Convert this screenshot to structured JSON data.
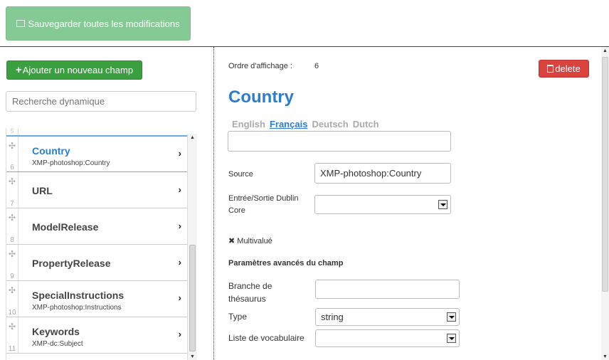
{
  "toolbar": {
    "save_label": "Sauvegarder toutes les modifications"
  },
  "sidebar": {
    "add_label": "Ajouter un nouveau champ",
    "add_plus": "+",
    "search_placeholder": "Recherche dynamique",
    "pre_num": "5",
    "items": [
      {
        "num": "6",
        "title": "Country",
        "sub": "XMP-photoshop:Country",
        "active": true
      },
      {
        "num": "7",
        "title": "URL",
        "sub": ""
      },
      {
        "num": "8",
        "title": "ModelRelease",
        "sub": ""
      },
      {
        "num": "9",
        "title": "PropertyRelease",
        "sub": ""
      },
      {
        "num": "10",
        "title": "SpecialInstructions",
        "sub": "XMP-photoshop:Instructions"
      },
      {
        "num": "11",
        "title": "Keywords",
        "sub": "XMP-dc:Subject"
      }
    ],
    "handle_icon": "move-handle-icon",
    "chevron": "›"
  },
  "detail": {
    "order_label": "Ordre d'affichage :",
    "order_value": "6",
    "delete_label": "delete",
    "title": "Country",
    "languages": [
      "English",
      "Français",
      "Deutsch",
      "Dutch"
    ],
    "active_language": "Français",
    "translation_value": "",
    "source_label": "Source",
    "source_value": "XMP-photoshop:Country",
    "dublin_label_1": "Entrée/Sortie Dublin",
    "dublin_label_2": "Core",
    "dublin_value": "",
    "multivalue_mark": "✖",
    "multivalue_label": "Multivalué",
    "advanced_heading": "Paramètres avancés du champ",
    "thesaurus_label_1": "Branche de",
    "thesaurus_label_2": "thésaurus",
    "thesaurus_value": "",
    "type_label": "Type",
    "type_value": "string",
    "vocab_label": "Liste de vocabulaire",
    "vocab_value": ""
  },
  "colors": {
    "accent": "#2a7ed0",
    "success": "#3a9f3f",
    "danger": "#d9423d",
    "save": "#85c994"
  }
}
